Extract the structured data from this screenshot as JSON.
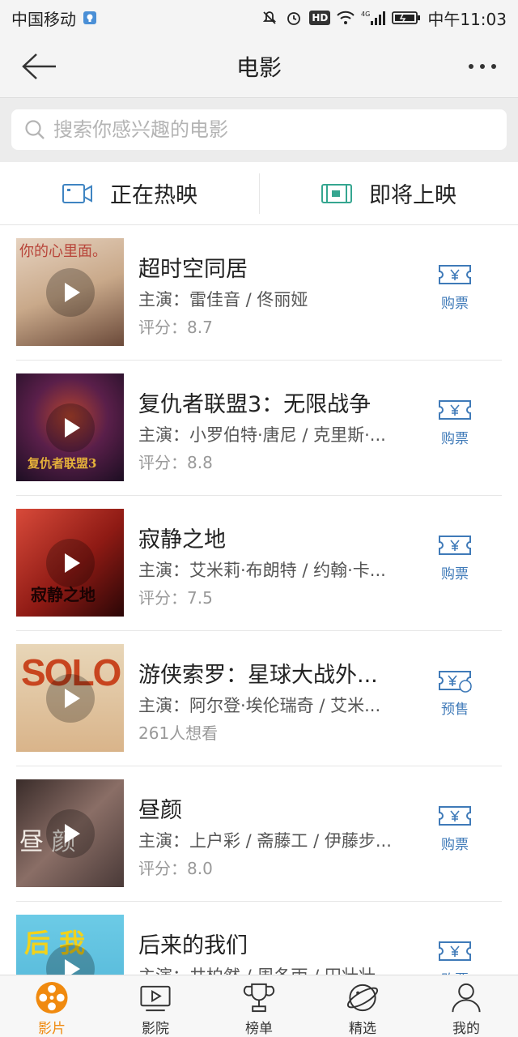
{
  "status_bar": {
    "carrier": "中国移动",
    "network": "4G",
    "time": "中午11:03",
    "hd": "HD"
  },
  "nav": {
    "title": "电影"
  },
  "search": {
    "placeholder": "搜索你感兴趣的电影",
    "value": ""
  },
  "tabs": [
    {
      "label": "正在热映",
      "icon": "video-camera-icon",
      "color": "#3f84c2"
    },
    {
      "label": "即将上映",
      "icon": "coming-soon-icon",
      "color": "#35a690"
    }
  ],
  "movies": [
    {
      "title": "超时空同居",
      "cast": "主演：雷佳音 / 佟丽娅",
      "info": "评分：8.7",
      "action": "购票",
      "poster_text": "你的心里面。",
      "poster_bg": "#c9a98a"
    },
    {
      "title": "复仇者联盟3：无限战争",
      "cast": "主演：小罗伯特·唐尼 / 克里斯·...",
      "info": "评分：8.8",
      "action": "购票",
      "poster_text": "复仇者联盟3",
      "poster_bg": "#3a1a3c"
    },
    {
      "title": "寂静之地",
      "cast": "主演：艾米莉·布朗特 / 约翰·卡...",
      "info": "评分：7.5",
      "action": "购票",
      "poster_text": "寂静之地",
      "poster_bg": "#7a1414"
    },
    {
      "title": "游侠索罗：星球大战外...",
      "cast": "主演：阿尔登·埃伦瑞奇 / 艾米...",
      "info": "261人想看",
      "action": "预售",
      "poster_text": "SOLO",
      "poster_bg": "#c8451f"
    },
    {
      "title": "昼颜",
      "cast": "主演：上户彩 / 斋藤工 / 伊藤步...",
      "info": "评分：8.0",
      "action": "购票",
      "poster_text": "昼 颜",
      "poster_bg": "#6b5a56"
    },
    {
      "title": "后来的我们",
      "cast": "主演：井柏然 / 周冬雨 / 田壮壮",
      "info": "",
      "action": "购票",
      "poster_text": "后 我",
      "poster_bg": "#5fc2e0"
    }
  ],
  "tabbar": [
    {
      "label": "影片",
      "icon": "film-reel-icon",
      "active": true
    },
    {
      "label": "影院",
      "icon": "cinema-screen-icon",
      "active": false
    },
    {
      "label": "榜单",
      "icon": "trophy-icon",
      "active": false
    },
    {
      "label": "精选",
      "icon": "planet-icon",
      "active": false
    },
    {
      "label": "我的",
      "icon": "user-icon",
      "active": false
    }
  ],
  "colors": {
    "accent": "#f08a0f",
    "buy_blue": "#3f7ab8"
  }
}
